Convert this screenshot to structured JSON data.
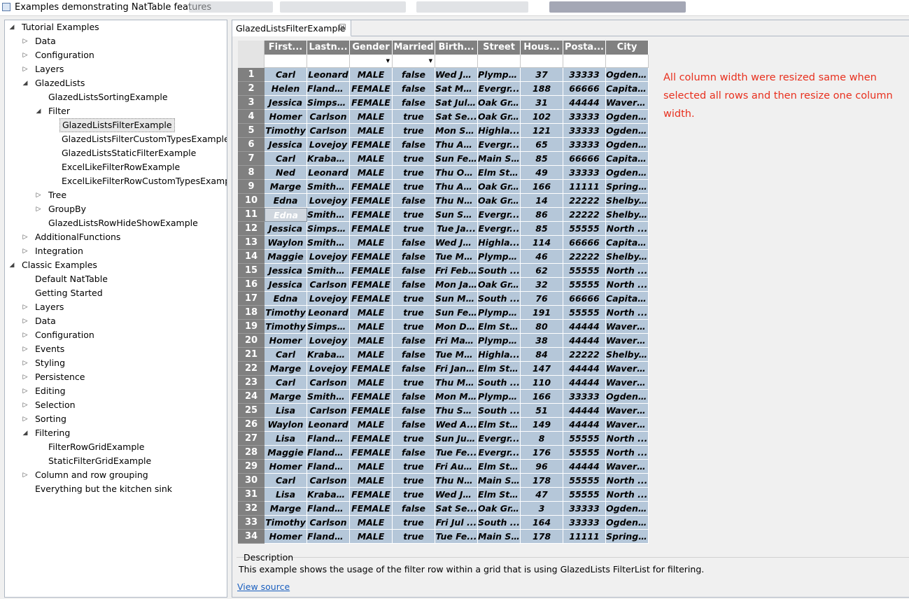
{
  "window": {
    "title": "Examples demonstrating NatTable features"
  },
  "tree": [
    {
      "label": "Tutorial Examples",
      "arrow": "◢",
      "level": 0
    },
    {
      "label": "Data",
      "arrow": "▷",
      "level": 1
    },
    {
      "label": "Configuration",
      "arrow": "▷",
      "level": 1
    },
    {
      "label": "Layers",
      "arrow": "▷",
      "level": 1
    },
    {
      "label": "GlazedLists",
      "arrow": "◢",
      "level": 1
    },
    {
      "label": "GlazedListsSortingExample",
      "arrow": "",
      "level": 2
    },
    {
      "label": "Filter",
      "arrow": "◢",
      "level": 2
    },
    {
      "label": "GlazedListsFilterExample",
      "arrow": "",
      "level": 3,
      "selected": true
    },
    {
      "label": "GlazedListsFilterCustomTypesExample",
      "arrow": "",
      "level": 3
    },
    {
      "label": "GlazedListsStaticFilterExample",
      "arrow": "",
      "level": 3
    },
    {
      "label": "ExcelLikeFilterRowExample",
      "arrow": "",
      "level": 3
    },
    {
      "label": "ExcelLikeFilterRowCustomTypesExample",
      "arrow": "",
      "level": 3
    },
    {
      "label": "Tree",
      "arrow": "▷",
      "level": 2
    },
    {
      "label": "GroupBy",
      "arrow": "▷",
      "level": 2
    },
    {
      "label": "GlazedListsRowHideShowExample",
      "arrow": "",
      "level": 2
    },
    {
      "label": "AdditionalFunctions",
      "arrow": "▷",
      "level": 1
    },
    {
      "label": "Integration",
      "arrow": "▷",
      "level": 1
    },
    {
      "label": "Classic Examples",
      "arrow": "◢",
      "level": 0
    },
    {
      "label": "Default NatTable",
      "arrow": "",
      "level": 1
    },
    {
      "label": "Getting Started",
      "arrow": "",
      "level": 1
    },
    {
      "label": "Layers",
      "arrow": "▷",
      "level": 1
    },
    {
      "label": "Data",
      "arrow": "▷",
      "level": 1
    },
    {
      "label": "Configuration",
      "arrow": "▷",
      "level": 1
    },
    {
      "label": "Events",
      "arrow": "▷",
      "level": 1
    },
    {
      "label": "Styling",
      "arrow": "▷",
      "level": 1
    },
    {
      "label": "Persistence",
      "arrow": "▷",
      "level": 1
    },
    {
      "label": "Editing",
      "arrow": "▷",
      "level": 1
    },
    {
      "label": "Selection",
      "arrow": "▷",
      "level": 1
    },
    {
      "label": "Sorting",
      "arrow": "▷",
      "level": 1
    },
    {
      "label": "Filtering",
      "arrow": "◢",
      "level": 1
    },
    {
      "label": "FilterRowGridExample",
      "arrow": "",
      "level": 2
    },
    {
      "label": "StaticFilterGridExample",
      "arrow": "",
      "level": 2
    },
    {
      "label": "Column and row grouping",
      "arrow": "▷",
      "level": 1
    },
    {
      "label": "Everything but the kitchen sink",
      "arrow": "",
      "level": 1
    }
  ],
  "tab": {
    "label": "GlazedListsFilterExample",
    "close": "☒"
  },
  "table": {
    "columns": [
      "First...",
      "Lastn...",
      "Gender",
      "Married",
      "Birth...",
      "Street",
      "Hous...",
      "Posta...",
      "City"
    ],
    "filter_dropdowns": [
      false,
      false,
      true,
      true,
      false,
      false,
      false,
      false,
      false
    ],
    "rows": [
      [
        "1",
        "Carl",
        "Leonard",
        "MALE",
        "false",
        "Wed Ju...",
        "Plympt...",
        "37",
        "33333",
        "Ogden..."
      ],
      [
        "2",
        "Helen",
        "Flanders",
        "FEMALE",
        "false",
        "Sat Ma...",
        "Evergr...",
        "188",
        "66666",
        "Capital..."
      ],
      [
        "3",
        "Jessica",
        "Simpson",
        "FEMALE",
        "false",
        "Sat Jul ...",
        "Oak Gr...",
        "31",
        "44444",
        "Waverl..."
      ],
      [
        "4",
        "Homer",
        "Carlson",
        "MALE",
        "true",
        "Sat Se...",
        "Oak Gr...",
        "102",
        "33333",
        "Ogden..."
      ],
      [
        "5",
        "Timothy",
        "Carlson",
        "MALE",
        "true",
        "Mon Se...",
        "Highla...",
        "121",
        "33333",
        "Ogden..."
      ],
      [
        "6",
        "Jessica",
        "Lovejoy",
        "FEMALE",
        "false",
        "Thu Ap...",
        "Evergr...",
        "65",
        "33333",
        "Ogden..."
      ],
      [
        "7",
        "Carl",
        "Krabap...",
        "MALE",
        "true",
        "Sun Fe...",
        "Main St...",
        "85",
        "66666",
        "Capital..."
      ],
      [
        "8",
        "Ned",
        "Leonard",
        "MALE",
        "true",
        "Thu Oc...",
        "Elm Str...",
        "49",
        "33333",
        "Ogden..."
      ],
      [
        "9",
        "Marge",
        "Smithers",
        "FEMALE",
        "true",
        "Thu Ap...",
        "Oak Gr...",
        "166",
        "11111",
        "Springf..."
      ],
      [
        "10",
        "Edna",
        "Lovejoy",
        "FEMALE",
        "false",
        "Thu No...",
        "Oak Gr...",
        "14",
        "22222",
        "Shelby..."
      ],
      [
        "11",
        "Edna",
        "Smithers",
        "FEMALE",
        "true",
        "Sun Se...",
        "Evergr...",
        "86",
        "22222",
        "Shelby..."
      ],
      [
        "12",
        "Jessica",
        "Simpson",
        "FEMALE",
        "true",
        "Tue Ja...",
        "Evergr...",
        "85",
        "55555",
        "North ..."
      ],
      [
        "13",
        "Waylon",
        "Smithers",
        "MALE",
        "false",
        "Wed Ja...",
        "Highla...",
        "114",
        "66666",
        "Capital..."
      ],
      [
        "14",
        "Maggie",
        "Lovejoy",
        "FEMALE",
        "false",
        "Tue Ma...",
        "Plympt...",
        "46",
        "22222",
        "Shelby..."
      ],
      [
        "15",
        "Jessica",
        "Smithers",
        "FEMALE",
        "false",
        "Fri Feb...",
        "South ...",
        "62",
        "55555",
        "North ..."
      ],
      [
        "16",
        "Jessica",
        "Carlson",
        "FEMALE",
        "false",
        "Mon Ja...",
        "Oak Gr...",
        "32",
        "55555",
        "North ..."
      ],
      [
        "17",
        "Edna",
        "Lovejoy",
        "FEMALE",
        "true",
        "Sun Ma...",
        "South ...",
        "76",
        "66666",
        "Capital..."
      ],
      [
        "18",
        "Timothy",
        "Leonard",
        "MALE",
        "true",
        "Sun Fe...",
        "Plympt...",
        "191",
        "55555",
        "North ..."
      ],
      [
        "19",
        "Timothy",
        "Simpson",
        "MALE",
        "true",
        "Mon De...",
        "Elm Str...",
        "80",
        "44444",
        "Waverl..."
      ],
      [
        "20",
        "Homer",
        "Lovejoy",
        "MALE",
        "false",
        "Fri May...",
        "Plympt...",
        "38",
        "44444",
        "Waverl..."
      ],
      [
        "21",
        "Carl",
        "Krabap...",
        "MALE",
        "false",
        "Tue Ma...",
        "Highla...",
        "84",
        "22222",
        "Shelby..."
      ],
      [
        "22",
        "Marge",
        "Lovejoy",
        "FEMALE",
        "false",
        "Fri Jan ...",
        "Elm Str...",
        "147",
        "44444",
        "Waverl..."
      ],
      [
        "23",
        "Carl",
        "Carlson",
        "MALE",
        "true",
        "Thu Ma...",
        "South ...",
        "110",
        "44444",
        "Waverl..."
      ],
      [
        "24",
        "Marge",
        "Smithers",
        "FEMALE",
        "false",
        "Mon M...",
        "Plympt...",
        "166",
        "33333",
        "Ogden..."
      ],
      [
        "25",
        "Lisa",
        "Carlson",
        "FEMALE",
        "false",
        "Thu Se...",
        "South ...",
        "51",
        "44444",
        "Waverl..."
      ],
      [
        "26",
        "Waylon",
        "Leonard",
        "MALE",
        "false",
        "Wed A...",
        "Elm Str...",
        "149",
        "44444",
        "Waverl..."
      ],
      [
        "27",
        "Lisa",
        "Flanders",
        "FEMALE",
        "true",
        "Sun Jul...",
        "Evergr...",
        "8",
        "55555",
        "North ..."
      ],
      [
        "28",
        "Maggie",
        "Flanders",
        "FEMALE",
        "false",
        "Tue Fe...",
        "Evergr...",
        "176",
        "55555",
        "North ..."
      ],
      [
        "29",
        "Homer",
        "Flanders",
        "MALE",
        "true",
        "Fri Aug...",
        "Elm Str...",
        "96",
        "44444",
        "Waverl..."
      ],
      [
        "30",
        "Carl",
        "Carlson",
        "MALE",
        "true",
        "Thu No...",
        "Main St...",
        "178",
        "55555",
        "North ..."
      ],
      [
        "31",
        "Lisa",
        "Krabap...",
        "FEMALE",
        "true",
        "Wed Ju...",
        "Elm Str...",
        "47",
        "55555",
        "North ..."
      ],
      [
        "32",
        "Marge",
        "Flanders",
        "FEMALE",
        "false",
        "Sat Se...",
        "Oak Gr...",
        "3",
        "33333",
        "Ogden..."
      ],
      [
        "33",
        "Timothy",
        "Carlson",
        "MALE",
        "true",
        "Fri Jul ...",
        "South ...",
        "164",
        "33333",
        "Ogden..."
      ],
      [
        "34",
        "Homer",
        "Flanders",
        "MALE",
        "true",
        "Tue Fe...",
        "Main St...",
        "178",
        "11111",
        "Springf..."
      ]
    ]
  },
  "note": "All column width were resized same when selected all rows and then resize one column width.",
  "description": {
    "title": "Description",
    "text": "This example shows the usage of the filter row within a grid that is using GlazedLists FilterList for filtering."
  },
  "view_source": "View source",
  "colors": {
    "header_bg": "#808080",
    "selected_cell_bg": "#b5c7d9",
    "note_text": "#e8301e",
    "link": "#1a5fbf"
  }
}
